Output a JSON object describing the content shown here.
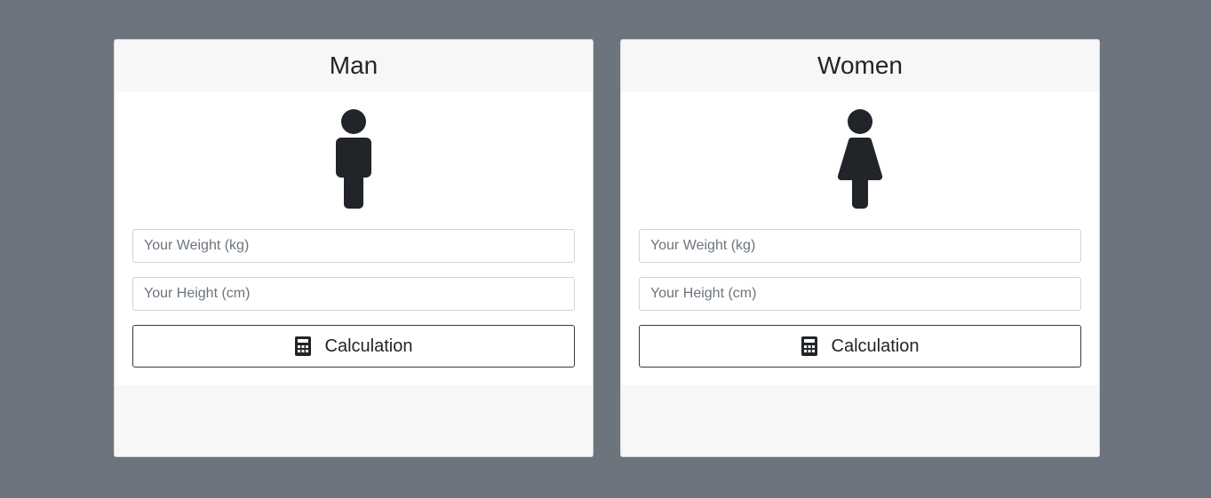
{
  "cards": [
    {
      "title": "Man",
      "icon": "male-figure-icon",
      "weight_placeholder": "Your Weight (kg)",
      "height_placeholder": "Your Height (cm)",
      "button_label": "Calculation",
      "button_icon": "calculator-icon"
    },
    {
      "title": "Women",
      "icon": "female-figure-icon",
      "weight_placeholder": "Your Weight (kg)",
      "height_placeholder": "Your Height (cm)",
      "button_label": "Calculation",
      "button_icon": "calculator-icon"
    }
  ],
  "colors": {
    "page_background": "#6c757d",
    "card_header": "#f7f7f7",
    "card_body": "#ffffff",
    "icon": "#212529",
    "button_border": "#343a40"
  }
}
